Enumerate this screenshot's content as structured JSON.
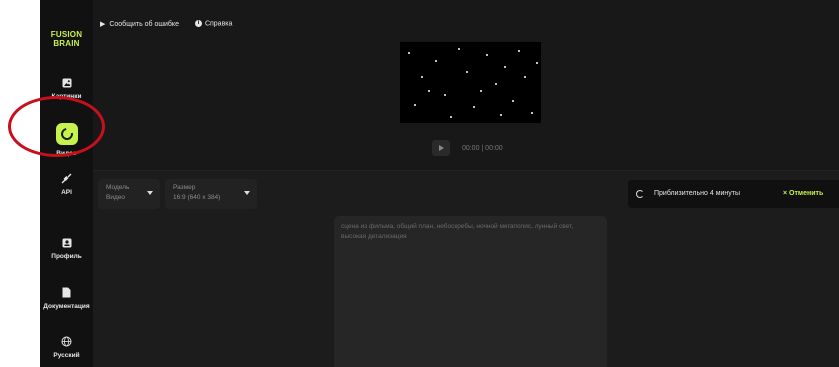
{
  "logo": {
    "line1": "FUSION",
    "line2": "BRAIN"
  },
  "sidebar": {
    "items": [
      {
        "label": "Картинки",
        "icon": "image-icon"
      },
      {
        "label": "Видео",
        "icon": "video-icon",
        "active": true
      },
      {
        "label": "API",
        "icon": "api-icon"
      },
      {
        "label": "Профиль",
        "icon": "profile-icon"
      },
      {
        "label": "Документация",
        "icon": "document-icon"
      },
      {
        "label": "Русский",
        "icon": "globe-icon"
      }
    ]
  },
  "topbar": {
    "report_bug": "Сообщить об ошибке",
    "help": "Справка"
  },
  "player": {
    "time": "00:00 | 00:00"
  },
  "controls": {
    "model": {
      "label": "Модель",
      "value": "Видео"
    },
    "size": {
      "label": "Размер",
      "value": "16:9 (640 x 384)"
    }
  },
  "status": {
    "text": "Приблизительно 4 минуты",
    "cancel": "Отменить",
    "cancel_icon": "×"
  },
  "prompt": {
    "placeholder": "сцена из фильма, общий план, небоскребы, ночной мегаполис, лунный свет, высокая детализация"
  },
  "colors": {
    "accent": "#c6f24e",
    "highlight_circle": "#c8101d",
    "background": "#181818"
  }
}
